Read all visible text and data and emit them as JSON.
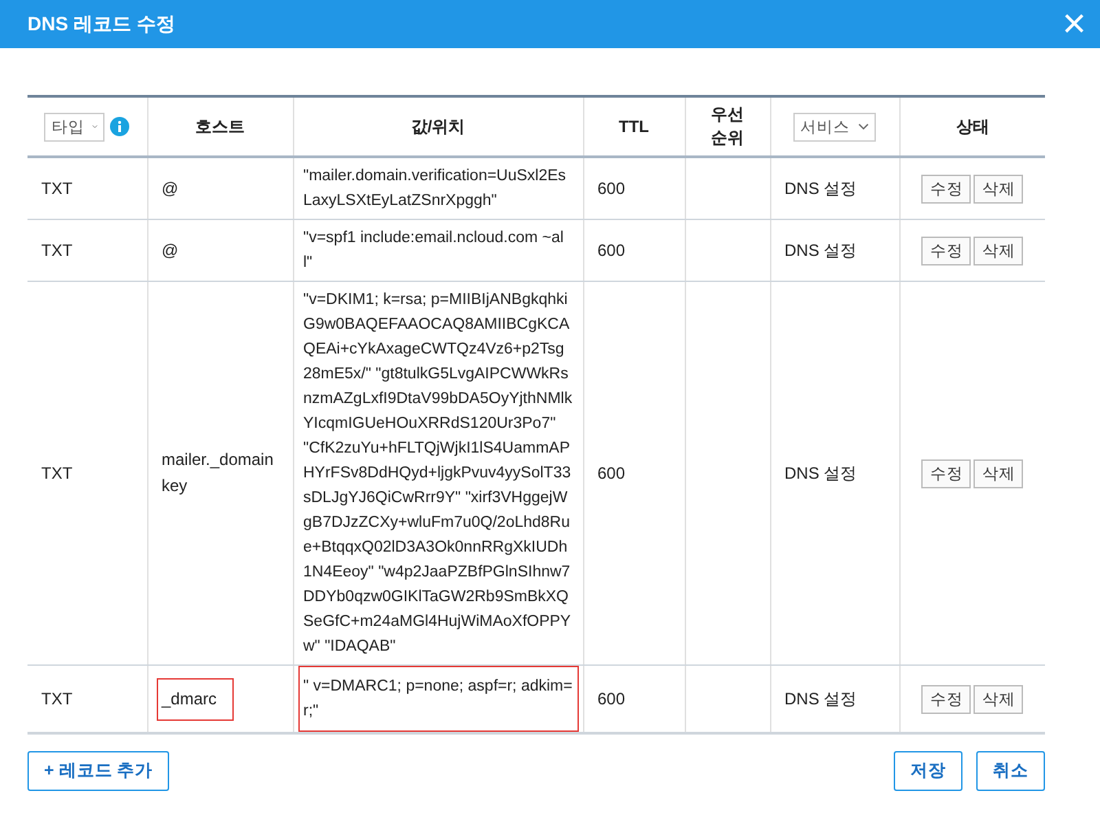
{
  "window": {
    "title": "DNS 레코드 수정",
    "close": "×"
  },
  "table": {
    "columns": [
      {
        "kind": "select",
        "label": "타입",
        "info": true
      },
      {
        "kind": "text",
        "label": "호스트"
      },
      {
        "kind": "text",
        "label": "값/위치"
      },
      {
        "kind": "text",
        "label": "TTL"
      },
      {
        "kind": "text",
        "label": "우선 순위"
      },
      {
        "kind": "select",
        "label": "서비스",
        "info": false
      },
      {
        "kind": "text",
        "label": "상태"
      }
    ],
    "rows": [
      {
        "type": "TXT",
        "host": "@",
        "value": "\"mailer.domain.verification=UuSxl2EsLaxyLSXtEyLatZSnrXpggh\"",
        "ttl": "600",
        "service": "DNS 설정",
        "edit": "수정",
        "delete": "삭제",
        "highlighted": false
      },
      {
        "type": "TXT",
        "host": "@",
        "value": "\"v=spf1 include:email.ncloud.com ~all\"",
        "ttl": "600",
        "service": "DNS 설정",
        "edit": "수정",
        "delete": "삭제",
        "highlighted": false
      },
      {
        "type": "TXT",
        "host": "mailer._domainkey",
        "value": "\"v=DKIM1; k=rsa; p=MIIBIjANBgkqhkiG9w0BAQEFAAOCAQ8AMIIBCgKCAQEAi+cYkAxageCWTQz4Vz6+p2Tsg28mE5x/\" \"gt8tulkG5LvgAIPCWWkRsnzmAZgLxfI9DtaV99bDA5OyYjthNMlkYIcqmIGUeHOuXRRdS120Ur3Po7\" \"CfK2zuYu+hFLTQjWjkI1lS4UammAPHYrFSv8DdHQyd+ljgkPvuv4yySolT33sDLJgYJ6QiCwRrr9Y\" \"xirf3VHggejWgB7DJzZCXy+wluFm7u0Q/2oLhd8Rue+BtqqxQ02lD3A3Ok0nnRRgXkIUDh1N4Eeoy\" \"w4p2JaaPZBfPGlnSIhnw7DDYb0qzw0GIKlTaGW2Rb9SmBkXQSeGfC+m24aMGl4HujWiMAoXfOPPYw\" \"IDAQAB\"",
        "ttl": "600",
        "service": "DNS 설정",
        "edit": "수정",
        "delete": "삭제",
        "highlighted": false
      },
      {
        "type": "TXT",
        "host": "_dmarc",
        "value": "\" v=DMARC1; p=none; aspf=r; adkim=r;\"",
        "ttl": "600",
        "service": "DNS 설정",
        "edit": "수정",
        "delete": "삭제",
        "highlighted": true
      }
    ]
  },
  "footer": {
    "add": "+ 레코드 추가",
    "save": "저장",
    "cancel": "취소"
  }
}
